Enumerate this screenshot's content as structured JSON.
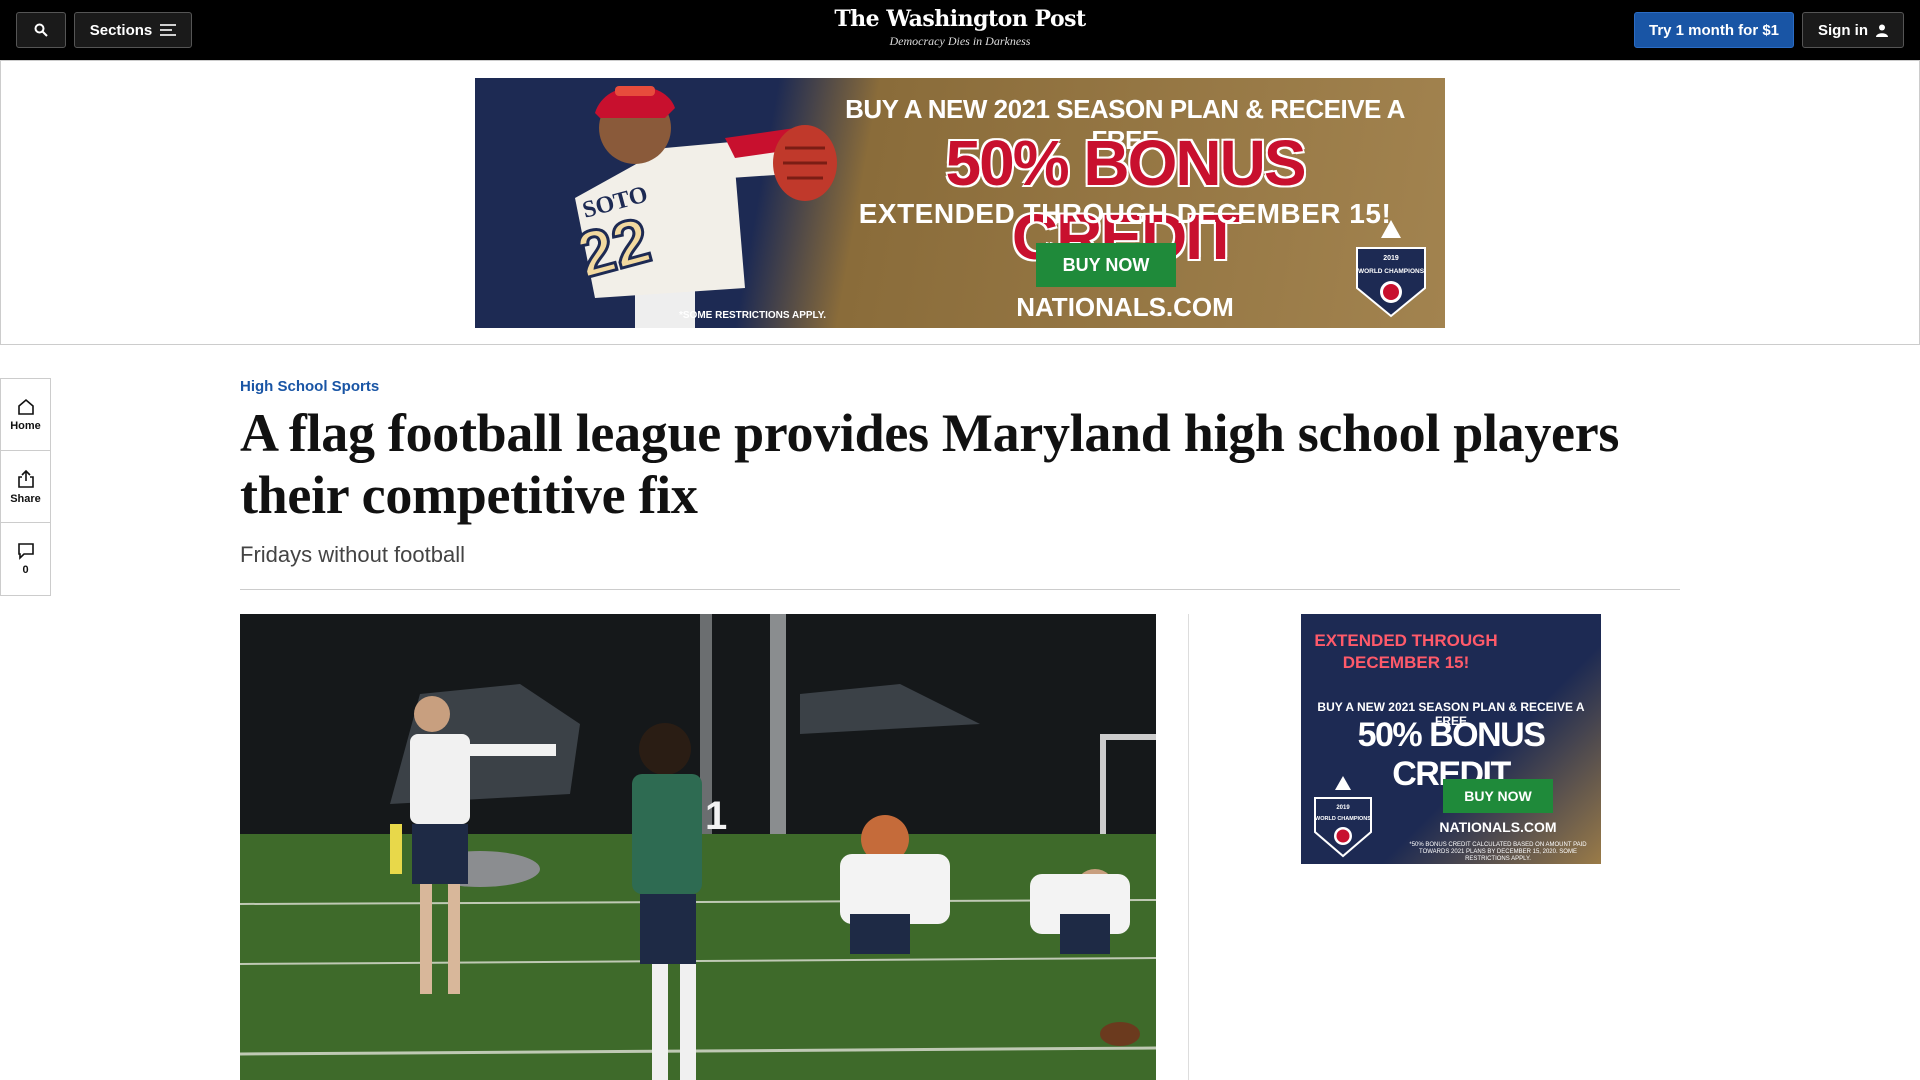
{
  "header": {
    "sections_label": "Sections",
    "logo": "The Washington Post",
    "tagline": "Democracy Dies in Darkness",
    "trial_label": "Try 1 month for $1",
    "signin_label": "Sign in"
  },
  "top_ad": {
    "line1": "BUY A NEW 2021 SEASON PLAN & RECEIVE A FREE",
    "line2": "50% BONUS CREDIT",
    "line3": "EXTENDED THROUGH DECEMBER 15!",
    "buy_label": "BUY NOW",
    "site": "NATIONALS.COM",
    "restrictions": "*SOME RESTRICTIONS APPLY.",
    "badge_year": "2019",
    "badge_title": "WORLD CHAMPIONS",
    "jersey_name": "SOTO",
    "jersey_number": "22"
  },
  "rail": {
    "home_label": "Home",
    "share_label": "Share",
    "comments_count": "0"
  },
  "article": {
    "kicker": "High School Sports",
    "headline": "A flag football league provides Maryland high school players their competitive fix",
    "subhead": "Fridays without football"
  },
  "side_ad": {
    "line1": "EXTENDED THROUGH DECEMBER 15!",
    "line2": "BUY A NEW 2021 SEASON PLAN & RECEIVE A FREE",
    "line3": "50% BONUS CREDIT",
    "buy_label": "BUY NOW",
    "site": "NATIONALS.COM",
    "fine_print": "*50% BONUS CREDIT CALCULATED BASED ON AMOUNT PAID TOWARDS 2021 PLANS BY DECEMBER 15, 2020. SOME RESTRICTIONS APPLY.",
    "badge_year": "2019",
    "badge_title": "WORLD CHAMPIONS"
  },
  "photo": {
    "jersey_number": "1"
  },
  "colors": {
    "accent": "#1955a5",
    "nav_bg": "#000000",
    "ad_navy": "#1d2a53",
    "ad_red": "#c8102e",
    "ad_green": "#1f8a3a"
  }
}
